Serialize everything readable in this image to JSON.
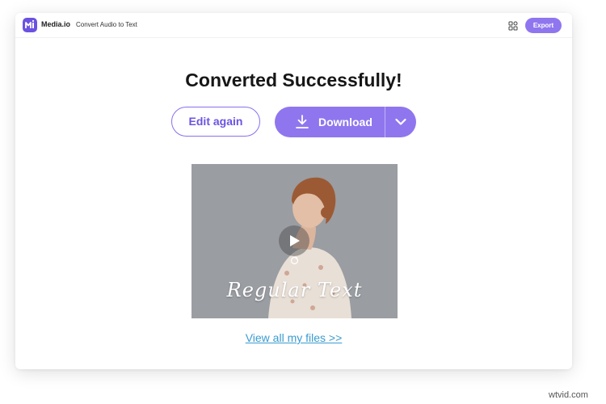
{
  "header": {
    "brand": "Media.io",
    "breadcrumb": "Convert Audio to Text",
    "export_label": "Export",
    "icons": {
      "logo": "mediaio-logo-icon",
      "apps": "grid-apps-icon"
    }
  },
  "main": {
    "headline": "Converted Successfully!",
    "edit_again_label": "Edit again",
    "download_label": "Download",
    "download_icon": "download-icon",
    "dropdown_icon": "chevron-down-icon",
    "preview": {
      "overlay_text": "Regular Text",
      "play_icon": "play-icon",
      "loop_icon": "loop-icon"
    },
    "view_files_link": "View all my files >>"
  },
  "watermark": "wtvid.com",
  "colors": {
    "accent": "#8f76ef",
    "accent_dark": "#6c53e2",
    "link": "#3a9bd0",
    "preview_bg": "#9a9da2"
  }
}
